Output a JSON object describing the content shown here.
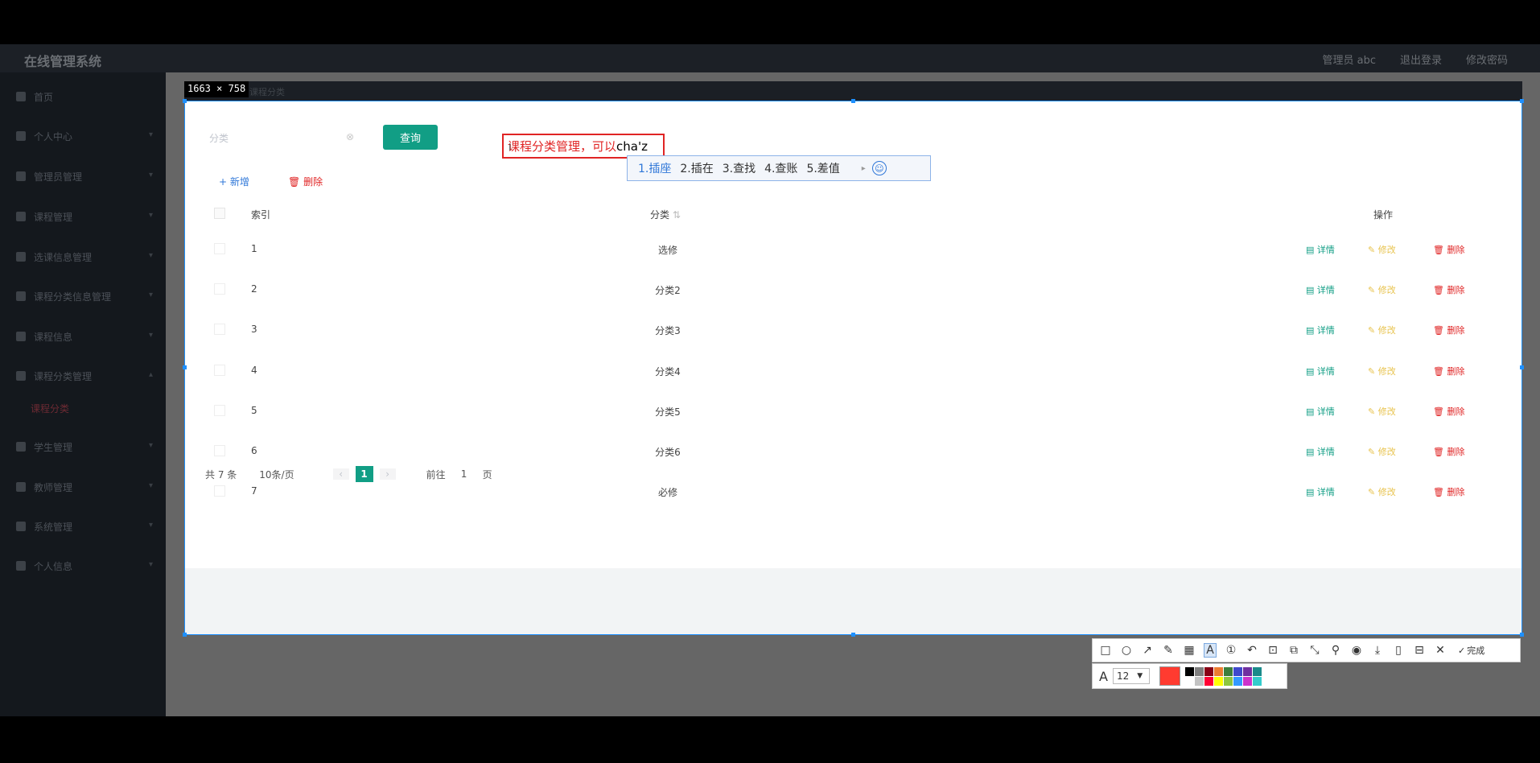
{
  "app": {
    "title": "在线管理系统",
    "header_right": [
      "管理员 abc",
      "退出登录",
      "修改密码"
    ]
  },
  "sidebar": {
    "items": [
      {
        "label": "首页",
        "icon": "home-icon"
      },
      {
        "label": "个人中心",
        "icon": "user-icon"
      },
      {
        "label": "管理员管理",
        "icon": "admin-icon"
      },
      {
        "label": "课程管理",
        "icon": "course-icon"
      },
      {
        "label": "选课信息管理",
        "icon": "list-icon"
      },
      {
        "label": "课程分类信息管理",
        "icon": "list-icon"
      },
      {
        "label": "课程信息",
        "icon": "info-icon"
      },
      {
        "label": "课程分类管理",
        "icon": "book-icon"
      },
      {
        "label": "课程分类",
        "icon": "",
        "sub": true
      },
      {
        "label": "学生管理",
        "icon": "student-icon"
      },
      {
        "label": "教师管理",
        "icon": "teacher-icon"
      },
      {
        "label": "系统管理",
        "icon": "system-icon"
      },
      {
        "label": "个人信息",
        "icon": "profile-icon"
      }
    ]
  },
  "capture": {
    "size_label": "1663 × 758",
    "breadcrumb": "课程分类"
  },
  "search": {
    "placeholder": "分类",
    "query_label": "查询"
  },
  "annotation": {
    "text": "课程分类管理，可以",
    "typed": "cha'z"
  },
  "ime": {
    "candidates": [
      "1.插座",
      "2.插在",
      "3.查找",
      "4.查账",
      "5.差值"
    ]
  },
  "actions": {
    "add_label": "+ 新增",
    "delete_label": "删除"
  },
  "table": {
    "columns": {
      "index": "索引",
      "category": "分类",
      "ops": "操作"
    },
    "rows": [
      {
        "index": "1",
        "category": "选修"
      },
      {
        "index": "2",
        "category": "分类2"
      },
      {
        "index": "3",
        "category": "分类3"
      },
      {
        "index": "4",
        "category": "分类4"
      },
      {
        "index": "5",
        "category": "分类5"
      },
      {
        "index": "6",
        "category": "分类6"
      },
      {
        "index": "7",
        "category": "必修"
      }
    ],
    "row_actions": {
      "detail": "详情",
      "edit": "修改",
      "delete": "删除"
    }
  },
  "pagination": {
    "total": "共 7 条",
    "page_size": "10条/页",
    "current_page": "1",
    "goto_label": "前往",
    "goto_value": "1",
    "page_unit": "页"
  },
  "toolbar": {
    "done_label": "完成",
    "font_size": "12",
    "current_color": "#ff3b30",
    "palette": [
      "#000000",
      "#7f7f7f",
      "#880015",
      "#ed7d31",
      "#3c7e3c",
      "#3f48cc",
      "#7030a0",
      "#1a8a8a",
      "#ffffff",
      "#c3c3c3",
      "#ff0033",
      "#ffff00",
      "#8dc63f",
      "#3399ff",
      "#cc33cc",
      "#33cccc"
    ]
  }
}
